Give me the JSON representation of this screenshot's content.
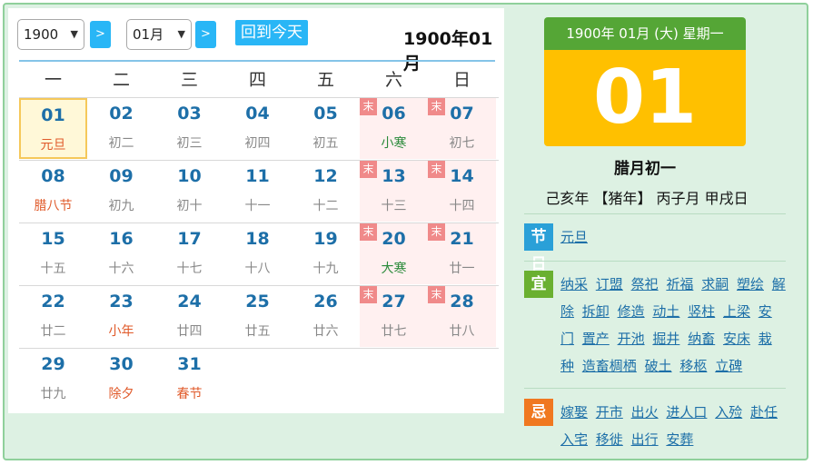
{
  "toolbar": {
    "year_value": "1900",
    "month_value": "01月",
    "next_label": ">",
    "today_label": "回到今天",
    "month_title": "1900年01月"
  },
  "weekdays": [
    "一",
    "二",
    "三",
    "四",
    "五",
    "六",
    "日"
  ],
  "rest_badge": "末",
  "days": [
    {
      "num": "01",
      "lunar": "元旦",
      "type": "fest",
      "weekend": false,
      "selected": true
    },
    {
      "num": "02",
      "lunar": "初二",
      "type": "",
      "weekend": false
    },
    {
      "num": "03",
      "lunar": "初三",
      "type": "",
      "weekend": false
    },
    {
      "num": "04",
      "lunar": "初四",
      "type": "",
      "weekend": false
    },
    {
      "num": "05",
      "lunar": "初五",
      "type": "",
      "weekend": false
    },
    {
      "num": "06",
      "lunar": "小寒",
      "type": "term",
      "weekend": true
    },
    {
      "num": "07",
      "lunar": "初七",
      "type": "",
      "weekend": true
    },
    {
      "num": "08",
      "lunar": "腊八节",
      "type": "fest",
      "weekend": false
    },
    {
      "num": "09",
      "lunar": "初九",
      "type": "",
      "weekend": false
    },
    {
      "num": "10",
      "lunar": "初十",
      "type": "",
      "weekend": false
    },
    {
      "num": "11",
      "lunar": "十一",
      "type": "",
      "weekend": false
    },
    {
      "num": "12",
      "lunar": "十二",
      "type": "",
      "weekend": false
    },
    {
      "num": "13",
      "lunar": "十三",
      "type": "",
      "weekend": true
    },
    {
      "num": "14",
      "lunar": "十四",
      "type": "",
      "weekend": true
    },
    {
      "num": "15",
      "lunar": "十五",
      "type": "",
      "weekend": false
    },
    {
      "num": "16",
      "lunar": "十六",
      "type": "",
      "weekend": false
    },
    {
      "num": "17",
      "lunar": "十七",
      "type": "",
      "weekend": false
    },
    {
      "num": "18",
      "lunar": "十八",
      "type": "",
      "weekend": false
    },
    {
      "num": "19",
      "lunar": "十九",
      "type": "",
      "weekend": false
    },
    {
      "num": "20",
      "lunar": "大寒",
      "type": "term",
      "weekend": true
    },
    {
      "num": "21",
      "lunar": "廿一",
      "type": "",
      "weekend": true
    },
    {
      "num": "22",
      "lunar": "廿二",
      "type": "",
      "weekend": false
    },
    {
      "num": "23",
      "lunar": "小年",
      "type": "fest",
      "weekend": false
    },
    {
      "num": "24",
      "lunar": "廿四",
      "type": "",
      "weekend": false
    },
    {
      "num": "25",
      "lunar": "廿五",
      "type": "",
      "weekend": false
    },
    {
      "num": "26",
      "lunar": "廿六",
      "type": "",
      "weekend": false
    },
    {
      "num": "27",
      "lunar": "廿七",
      "type": "",
      "weekend": true
    },
    {
      "num": "28",
      "lunar": "廿八",
      "type": "",
      "weekend": true
    },
    {
      "num": "29",
      "lunar": "廿九",
      "type": "",
      "weekend": false
    },
    {
      "num": "30",
      "lunar": "除夕",
      "type": "fest",
      "weekend": false
    },
    {
      "num": "31",
      "lunar": "春节",
      "type": "fest",
      "weekend": false
    }
  ],
  "detail": {
    "header": "1900年 01月 (大) 星期一",
    "day": "01",
    "lunar_date": "腊月初一",
    "ganzhi": "己亥年 【猪年】 丙子月 甲戌日",
    "festival_tag": "节日",
    "festivals": [
      "元旦"
    ],
    "yi_tag": "宜",
    "yi": [
      "纳采",
      "订盟",
      "祭祀",
      "祈福",
      "求嗣",
      "塑绘",
      "解除",
      "拆卸",
      "修造",
      "动土",
      "竖柱",
      "上梁",
      "安门",
      "置产",
      "开池",
      "掘井",
      "纳畜",
      "安床",
      "栽种",
      "造畜椆栖",
      "破土",
      "移柩",
      "立碑"
    ],
    "ji_tag": "忌",
    "ji": [
      "嫁娶",
      "开市",
      "出火",
      "进人口",
      "入殓",
      "赴任",
      "入宅",
      "移徙",
      "出行",
      "安葬"
    ]
  },
  "colors": {
    "accent_blue": "#29b6f6",
    "day_number": "#1d6fa8",
    "card_header": "#55a636",
    "card_day": "#ffc000",
    "festival_text": "#e05a2a",
    "term_text": "#2a8a3a"
  }
}
